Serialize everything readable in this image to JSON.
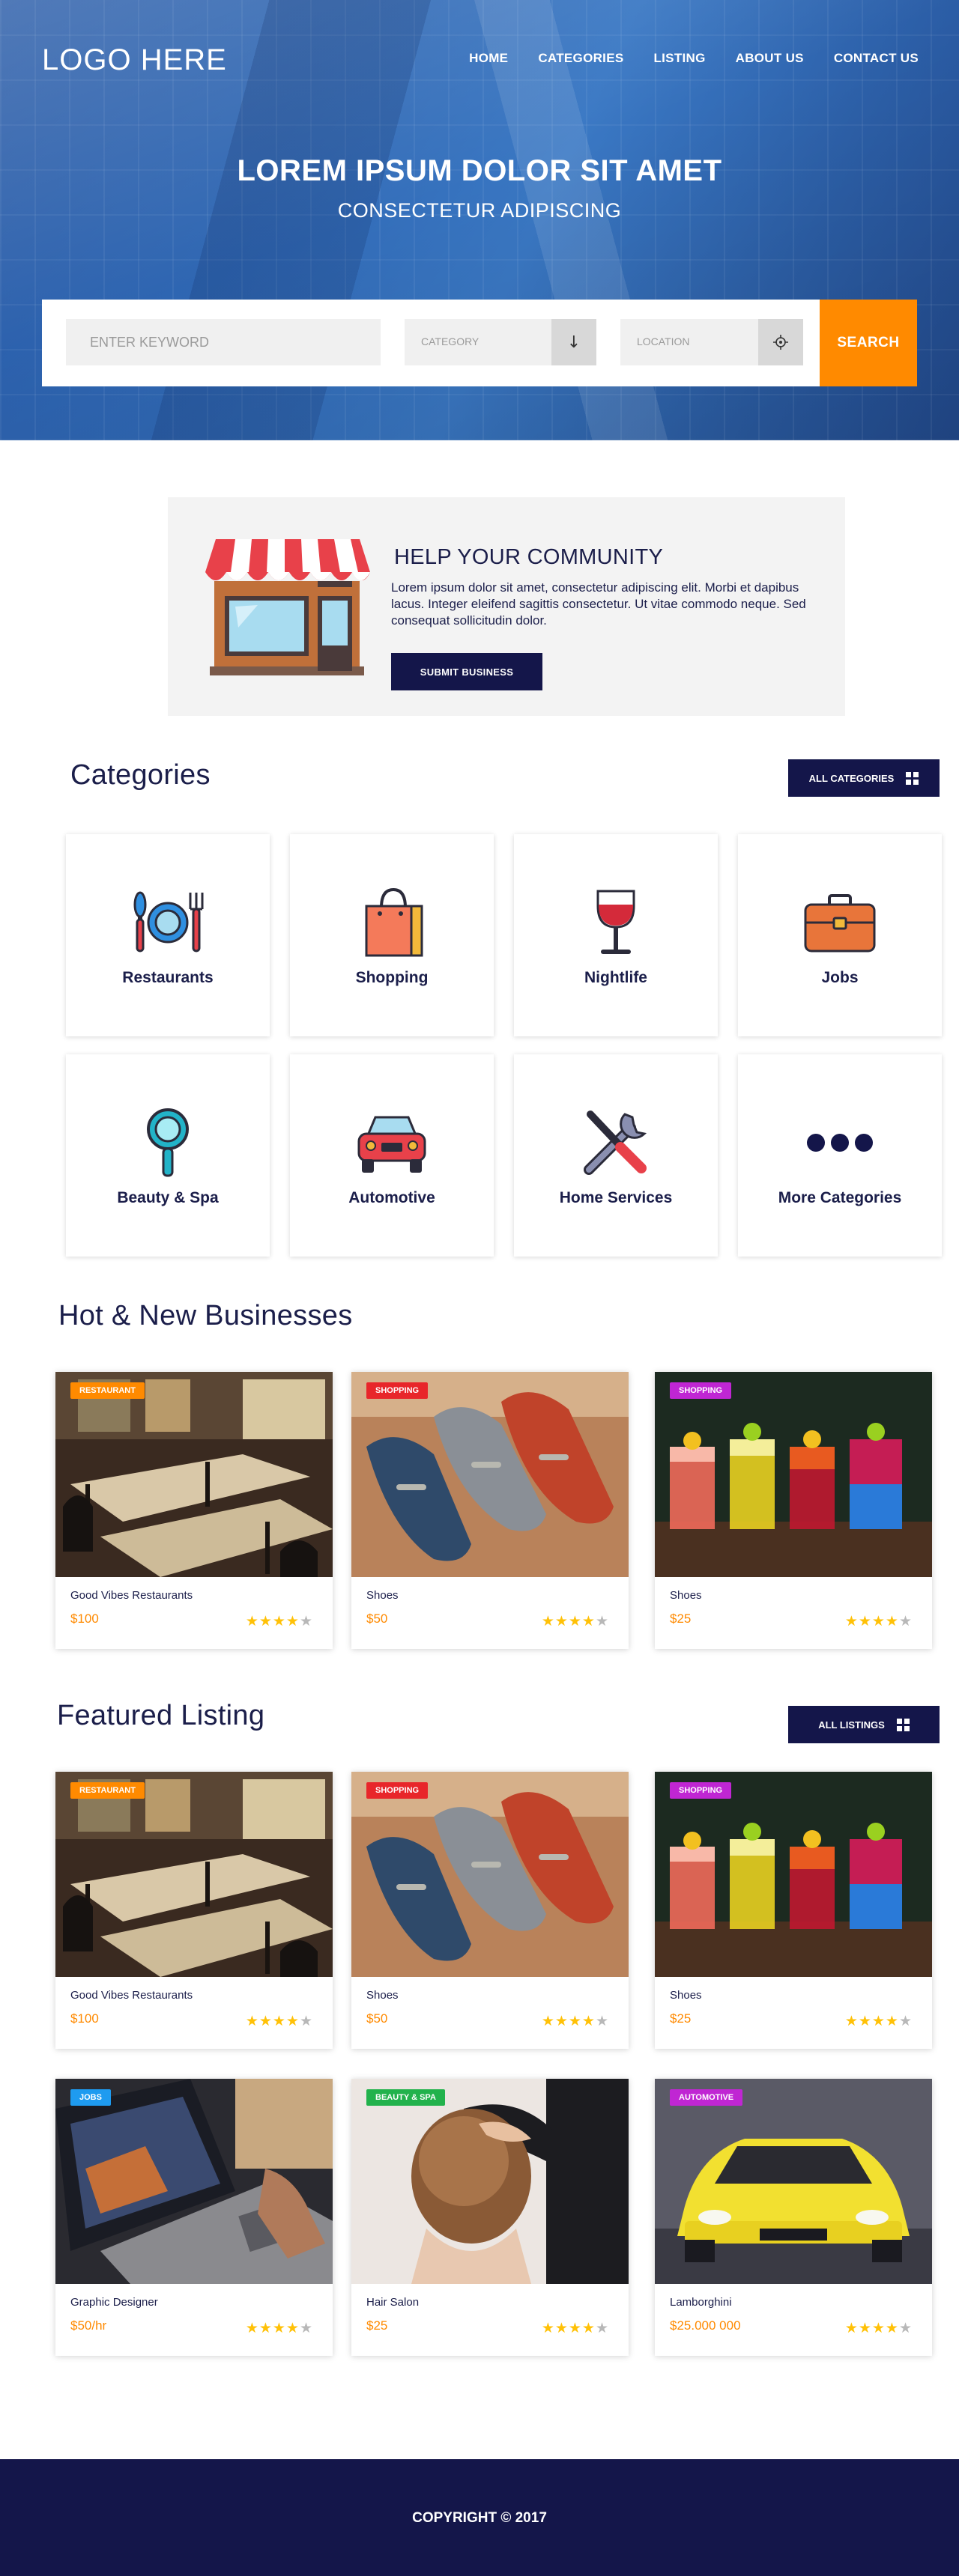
{
  "header": {
    "logo": "LOGO HERE",
    "nav": [
      "HOME",
      "CATEGORIES",
      "LISTING",
      "ABOUT US",
      "CONTACT US"
    ]
  },
  "hero": {
    "title": "LOREM IPSUM DOLOR SIT AMET",
    "subtitle": "CONSECTETUR ADIPISCING"
  },
  "search": {
    "keyword_placeholder": "ENTER KEYWORD",
    "category_label": "CATEGORY",
    "location_label": "LOCATION",
    "button": "SEARCH"
  },
  "community": {
    "title": "HELP YOUR COMMUNITY",
    "text": "Lorem ipsum dolor sit amet, consectetur adipiscing elit. Morbi et dapibus lacus. Integer eleifend sagittis consectetur. Ut vitae commodo neque. Sed consequat sollicitudin dolor.",
    "button": "SUBMIT BUSINESS"
  },
  "categories": {
    "title": "Categories",
    "button": "ALL CATEGORIES",
    "items": [
      {
        "label": "Restaurants",
        "icon": "restaurant-icon"
      },
      {
        "label": "Shopping",
        "icon": "shopping-bag-icon"
      },
      {
        "label": "Nightlife",
        "icon": "wine-glass-icon"
      },
      {
        "label": "Jobs",
        "icon": "briefcase-icon"
      },
      {
        "label": "Beauty & Spa",
        "icon": "hand-mirror-icon"
      },
      {
        "label": "Automotive",
        "icon": "car-icon"
      },
      {
        "label": "Home Services",
        "icon": "tools-icon"
      },
      {
        "label": "More Categories",
        "icon": "more-dots-icon"
      }
    ]
  },
  "hot_new": {
    "title": "Hot & New Businesses",
    "items": [
      {
        "badge": "RESTAURANT",
        "badge_color": "#ff8a00",
        "name": "Good Vibes Restaurants",
        "price": "$100",
        "rating": 4
      },
      {
        "badge": "SHOPPING",
        "badge_color": "#e8262a",
        "name": "Shoes",
        "price": "$50",
        "rating": 4
      },
      {
        "badge": "SHOPPING",
        "badge_color": "#c026d3",
        "name": "Shoes",
        "price": "$25",
        "rating": 4
      }
    ]
  },
  "featured": {
    "title": "Featured Listing",
    "button": "ALL LISTINGS",
    "items": [
      {
        "badge": "RESTAURANT",
        "badge_color": "#ff8a00",
        "name": "Good Vibes Restaurants",
        "price": "$100",
        "rating": 4
      },
      {
        "badge": "SHOPPING",
        "badge_color": "#e8262a",
        "name": "Shoes",
        "price": "$50",
        "rating": 4
      },
      {
        "badge": "SHOPPING",
        "badge_color": "#c026d3",
        "name": "Shoes",
        "price": "$25",
        "rating": 4
      },
      {
        "badge": "JOBS",
        "badge_color": "#1e9bf0",
        "name": "Graphic Designer",
        "price": "$50/hr",
        "rating": 4
      },
      {
        "badge": "BEAUTY & SPA",
        "badge_color": "#22b24c",
        "name": "Hair Salon",
        "price": "$25",
        "rating": 4
      },
      {
        "badge": "AUTOMOTIVE",
        "badge_color": "#c026d3",
        "name": "Lamborghini",
        "price": "$25.000 000",
        "rating": 4
      }
    ]
  },
  "footer": {
    "copyright": "COPYRIGHT © 2017"
  },
  "colors": {
    "navy": "#14164a",
    "accent": "#ff8a00",
    "star": "#ffc107"
  }
}
